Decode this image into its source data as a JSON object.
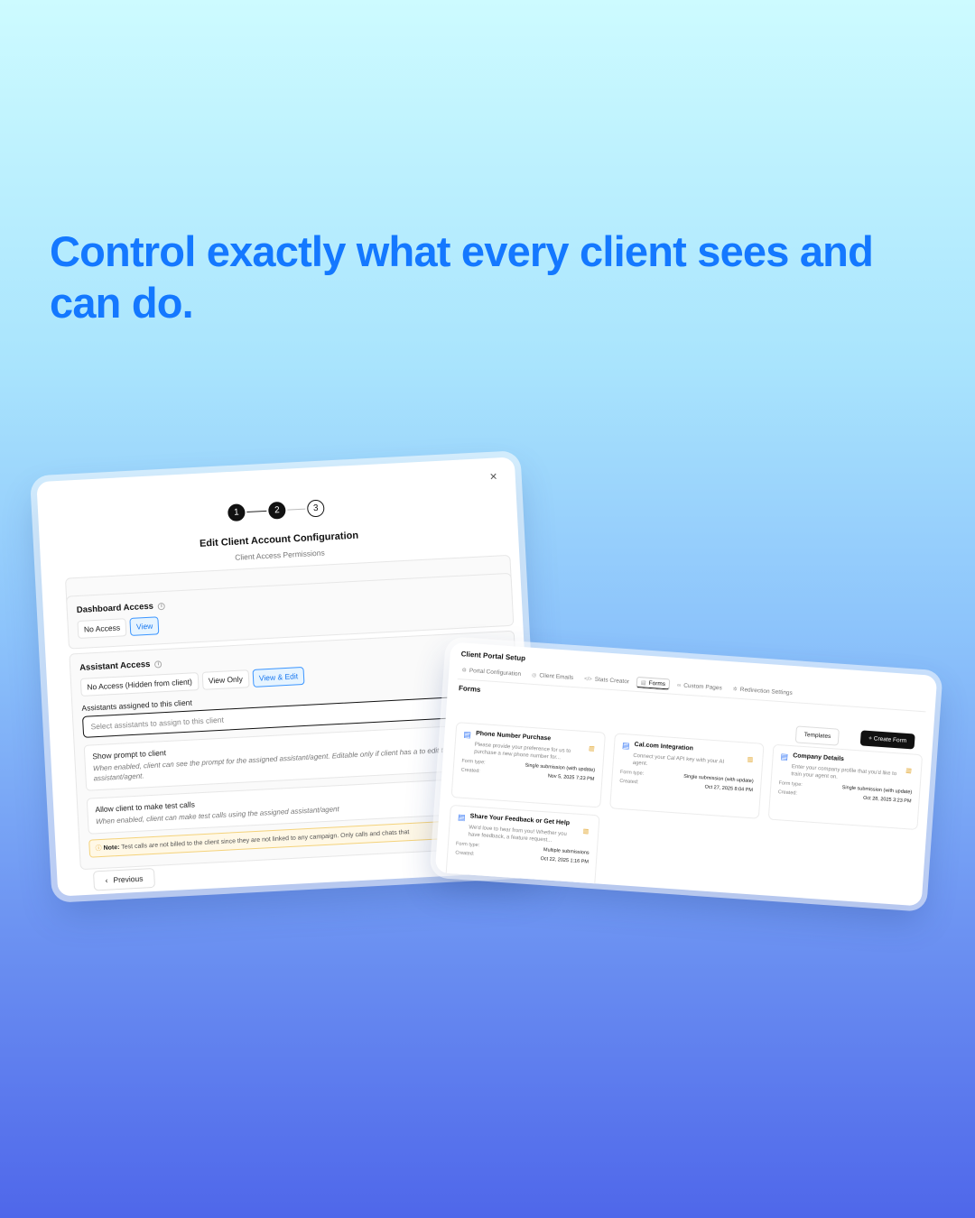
{
  "headline": "Control exactly what every client sees and can do.",
  "modal": {
    "close_icon": "×",
    "steps": [
      "1",
      "2",
      "3"
    ],
    "title": "Edit Client Account Configuration",
    "subtitle": "Client Access Permissions",
    "dashboard_access": {
      "label": "Dashboard Access",
      "options": [
        "No Access",
        "View"
      ],
      "selected": "View"
    },
    "assistant_access": {
      "label": "Assistant Access",
      "options": [
        "No Access (Hidden from client)",
        "View Only",
        "View & Edit"
      ],
      "selected": "View & Edit",
      "assign_label": "Assistants assigned to this client",
      "assign_placeholder": "Select assistants to assign to this client",
      "show_prompt_title": "Show prompt to client",
      "show_prompt_desc": "When enabled, client can see the prompt for the assigned assistant/agent. Editable only if client has a to edit the assistant/agent.",
      "test_calls_title": "Allow client to make test calls",
      "test_calls_desc": "When enabled, client can make test calls using the assigned assistant/agent",
      "note_label": "Note:",
      "note_text": "Test calls are not billed to the client since they are not linked to any campaign. Only calls and chats that"
    },
    "previous_label": "Previous"
  },
  "portal": {
    "title": "Client Portal Setup",
    "tabs": [
      "Portal Configuration",
      "Client Emails",
      "Stats Creator",
      "Forms",
      "Custom Pages",
      "Redirection Settings"
    ],
    "active_tab": "Forms",
    "section_title": "Forms",
    "templates_label": "Templates",
    "create_label": "+ Create Form",
    "form_type_label": "Form type:",
    "created_label": "Created:",
    "forms": [
      {
        "title": "Phone Number Purchase",
        "desc": "Please provide your preference for us to purchase a new phone number for...",
        "type": "Single submission (with update)",
        "created": "Nov 5, 2025 7:23 PM"
      },
      {
        "title": "Cal.com Integration",
        "desc": "Connect your Cal API key with your AI agent.",
        "type": "Single submission (with update)",
        "created": "Oct 27, 2025 8:04 PM"
      },
      {
        "title": "Company Details",
        "desc": "Enter your company profile that you'd like to train your agent on.",
        "type": "Single submission (with update)",
        "created": "Oct 28, 2025 3:23 PM"
      },
      {
        "title": "Share Your Feedback or Get Help",
        "desc": "We'd love to hear from you! Whether you have feedback, a feature request...",
        "type": "Multiple submissions",
        "created": "Oct 22, 2025 1:16 PM"
      }
    ]
  },
  "colors": {
    "headline": "#1478ff",
    "accent": "#1878f0",
    "note_bg": "#fff8e6"
  }
}
